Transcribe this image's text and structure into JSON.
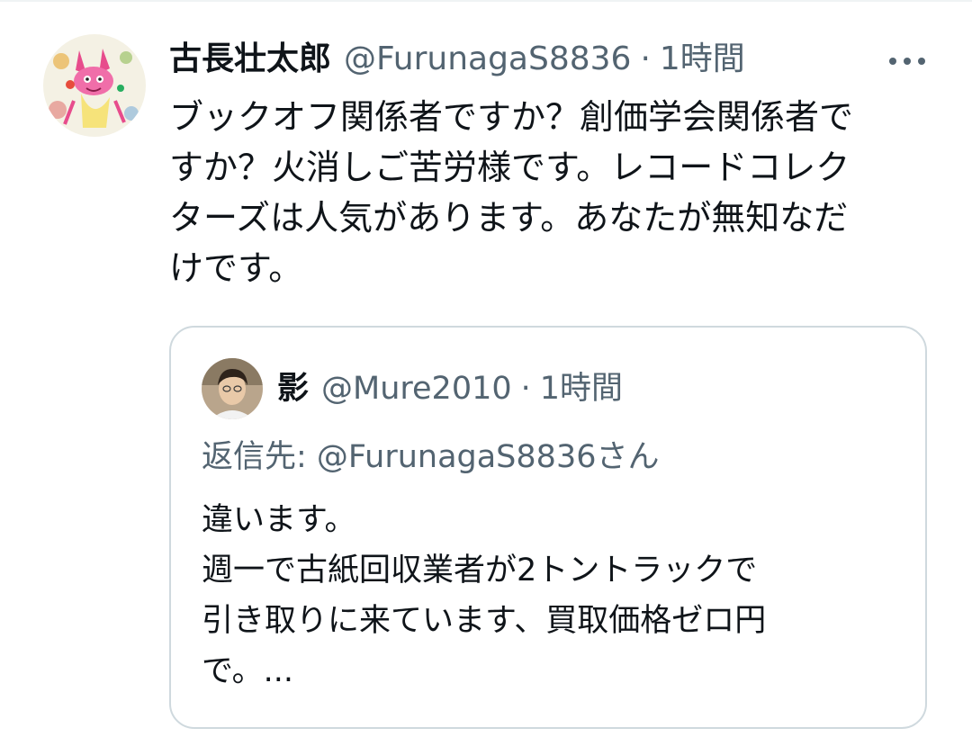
{
  "tweet": {
    "display_name": "古長壮太郎",
    "handle": "@FurunagaS8836",
    "separator": "·",
    "time": "1時間",
    "text": "ブックオフ関係者ですか？創価学会関係者で\nすか？火消しご苦労様です。レコードコレク\nターズは人気があります。あなたが無知なだ\nけです。",
    "avatar_icon": "cartoon-illustration-avatar",
    "more_icon": "more-options-icon"
  },
  "quote": {
    "display_name": "影",
    "handle": "@Mure2010",
    "separator": "·",
    "time": "1時間",
    "reply_to": "返信先: @FurunagaS8836さん",
    "lines": [
      "違います。",
      "週一で古紙回収業者が2トントラックで",
      "引き取りに来ています、買取価格ゼロ円",
      "で。..."
    ],
    "avatar_icon": "person-photo-avatar"
  },
  "colors": {
    "text_primary": "#0f1419",
    "text_secondary": "#536471",
    "border": "#cfd9de"
  }
}
